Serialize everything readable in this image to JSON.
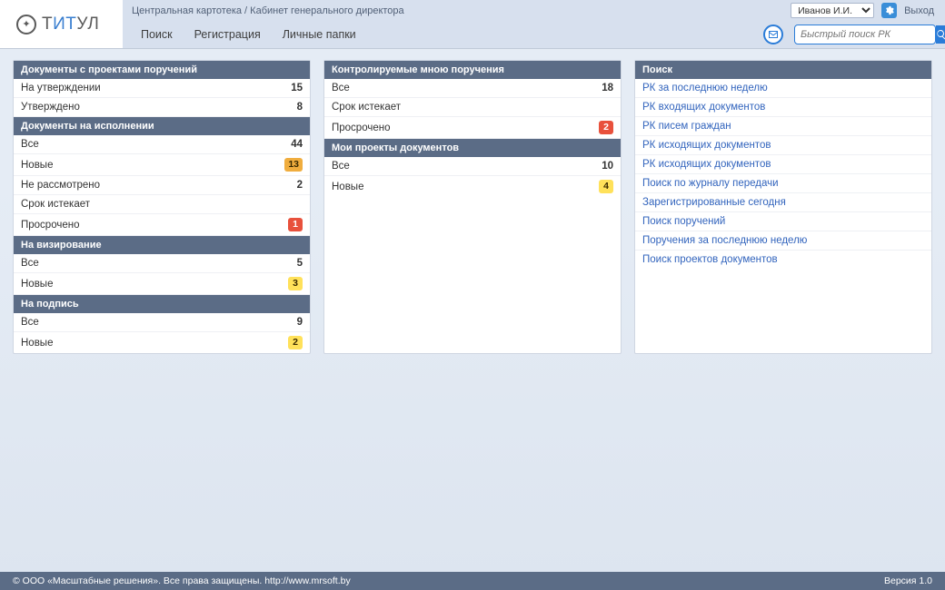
{
  "logo": {
    "t1": "Т",
    "t2": "ИТ",
    "t3": "УЛ"
  },
  "breadcrumb": "Центральная картотека / Кабинет генерального директора",
  "user": "Иванов И.И.",
  "logout": "Выход",
  "nav": {
    "search": "Поиск",
    "register": "Регистрация",
    "folders": "Личные папки"
  },
  "quick_search_placeholder": "Быстрый поиск РК",
  "col1": {
    "s0": {
      "title": "Документы с проектами поручений",
      "items": [
        {
          "label": "На утверждении",
          "count": "15",
          "style": "plain"
        },
        {
          "label": "Утверждено",
          "count": "8",
          "style": "plain"
        }
      ]
    },
    "s1": {
      "title": "Документы на исполнении",
      "items": [
        {
          "label": "Все",
          "count": "44",
          "style": "plain"
        },
        {
          "label": "Новые",
          "count": "13",
          "style": "orange"
        },
        {
          "label": "Не рассмотрено",
          "count": "2",
          "style": "plain"
        },
        {
          "label": "Срок истекает",
          "count": "",
          "style": "none"
        },
        {
          "label": "Просрочено",
          "count": "1",
          "style": "red"
        }
      ]
    },
    "s2": {
      "title": "На визирование",
      "items": [
        {
          "label": "Все",
          "count": "5",
          "style": "plain"
        },
        {
          "label": "Новые",
          "count": "3",
          "style": "yellow"
        }
      ]
    },
    "s3": {
      "title": "На подпись",
      "items": [
        {
          "label": "Все",
          "count": "9",
          "style": "plain"
        },
        {
          "label": "Новые",
          "count": "2",
          "style": "yellow"
        }
      ]
    }
  },
  "col2": {
    "s0": {
      "title": "Контролируемые мною поручения",
      "items": [
        {
          "label": "Все",
          "count": "18",
          "style": "plain"
        },
        {
          "label": "Срок истекает",
          "count": "",
          "style": "none"
        },
        {
          "label": "Просрочено",
          "count": "2",
          "style": "red"
        }
      ]
    },
    "s1": {
      "title": "Мои проекты документов",
      "items": [
        {
          "label": "Все",
          "count": "10",
          "style": "plain"
        },
        {
          "label": "Новые",
          "count": "4",
          "style": "yellow"
        }
      ]
    }
  },
  "col3": {
    "title": "Поиск",
    "items": [
      "РК за последнюю неделю",
      "РК входящих документов",
      "РК писем граждан",
      "РК исходящих документов",
      "РК исходящих документов",
      "Поиск по журналу передачи",
      "Зарегистрированные сегодня",
      "Поиск поручений",
      "Поручения за последнюю неделю",
      "Поиск проектов документов"
    ]
  },
  "footer": {
    "copyright": "©  ООО «Масштабные решения». Все права защищены. http://www.mrsoft.by",
    "version": "Версия 1.0"
  }
}
